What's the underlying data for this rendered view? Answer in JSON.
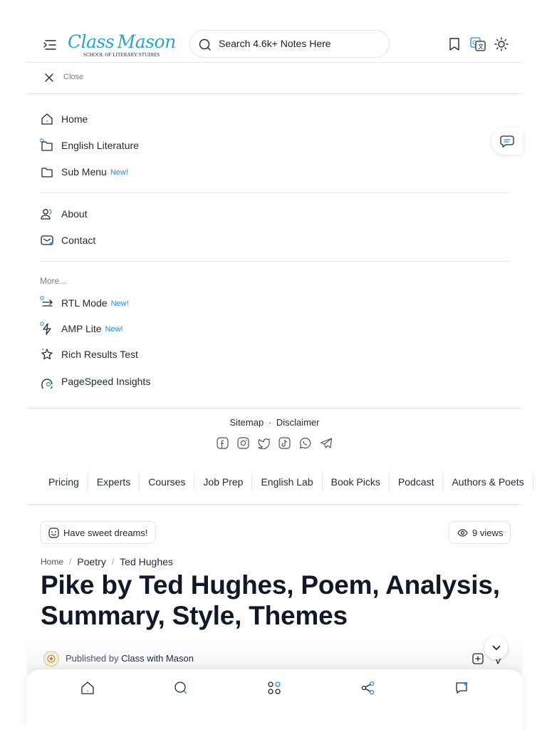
{
  "header": {
    "logo_main": "Class Mason",
    "logo_sub": "SCHOOL OF LITERARY STUDIES",
    "search_placeholder": "Search 4.6k+ Notes Here"
  },
  "drawer": {
    "close_label": "Close",
    "main_items": [
      {
        "label": "Home",
        "icon": "home-icon"
      },
      {
        "label": "English Literature",
        "icon": "folder-icon"
      },
      {
        "label": "Sub Menu",
        "badge": "New!",
        "icon": "folder-icon"
      }
    ],
    "info_items": [
      {
        "label": "About",
        "icon": "users-icon"
      },
      {
        "label": "Contact",
        "icon": "mail-icon"
      }
    ],
    "more_label": "More...",
    "more_items": [
      {
        "label": "RTL Mode",
        "badge": "New!",
        "icon": "swap-icon"
      },
      {
        "label": "AMP Lite",
        "badge": "New!",
        "icon": "bolt-icon"
      },
      {
        "label": "Rich Results Test",
        "icon": "star-icon"
      },
      {
        "label": "PageSpeed Insights",
        "icon": "gauge-icon"
      }
    ]
  },
  "footer": {
    "sitemap": "Sitemap",
    "separator": "·",
    "disclaimer": "Disclaimer",
    "social_icons": [
      "facebook-icon",
      "instagram-icon",
      "twitter-icon",
      "tiktok-icon",
      "whatsapp-icon",
      "telegram-icon"
    ]
  },
  "nav_strip": [
    "Pricing",
    "Experts",
    "Courses",
    "Job Prep",
    "English Lab",
    "Book Picks",
    "Podcast",
    "Authors & Poets"
  ],
  "post": {
    "greeting": "Have sweet dreams!",
    "views": "9 views",
    "breadcrumb": {
      "home": "Home",
      "category": "Poetry",
      "subcategory": "Ted Hughes"
    },
    "title": "Pike by Ted Hughes, Poem, Analysis, Summary, Style, Themes",
    "published_prefix": "Published by",
    "author": "Class with Mason"
  },
  "colors": {
    "accent": "#2b8ad6",
    "logo": "#2ba6c2",
    "text": "#1f2937"
  }
}
